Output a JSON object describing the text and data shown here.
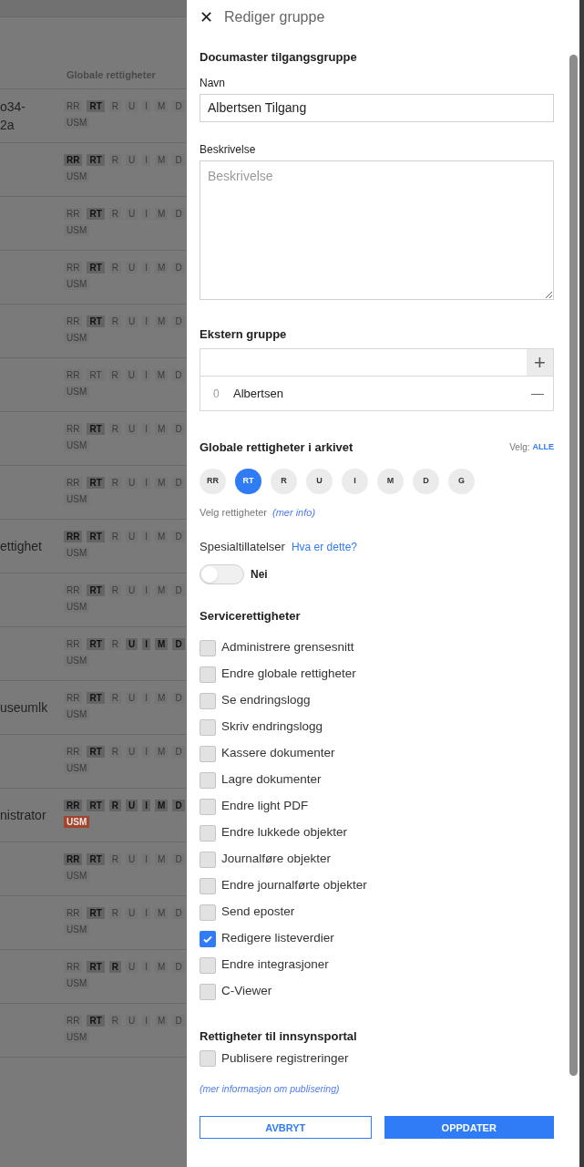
{
  "background_table": {
    "column_header": "Globale rettigheter",
    "rows": [
      {
        "lines": [
          "o34-",
          "2a"
        ],
        "rights": [
          {
            "label": "RR",
            "on": false
          },
          {
            "label": "RT",
            "on": true
          },
          {
            "label": "R",
            "on": false
          },
          {
            "label": "U",
            "on": false
          },
          {
            "label": "I",
            "on": false
          },
          {
            "label": "M",
            "on": false
          },
          {
            "label": "D",
            "on": false
          },
          {
            "label": "USM",
            "on": false
          }
        ]
      },
      {
        "lines": [],
        "rights": [
          {
            "label": "RR",
            "on": true
          },
          {
            "label": "RT",
            "on": true
          },
          {
            "label": "R",
            "on": false
          },
          {
            "label": "U",
            "on": false
          },
          {
            "label": "I",
            "on": false
          },
          {
            "label": "M",
            "on": false
          },
          {
            "label": "D",
            "on": false
          },
          {
            "label": "USM",
            "on": false
          }
        ]
      },
      {
        "lines": [],
        "rights": [
          {
            "label": "RR",
            "on": false
          },
          {
            "label": "RT",
            "on": true
          },
          {
            "label": "R",
            "on": false
          },
          {
            "label": "U",
            "on": false
          },
          {
            "label": "I",
            "on": false
          },
          {
            "label": "M",
            "on": false
          },
          {
            "label": "D",
            "on": false
          },
          {
            "label": "USM",
            "on": false
          }
        ]
      },
      {
        "lines": [],
        "rights": [
          {
            "label": "RR",
            "on": false
          },
          {
            "label": "RT",
            "on": true
          },
          {
            "label": "R",
            "on": false
          },
          {
            "label": "U",
            "on": false
          },
          {
            "label": "I",
            "on": false
          },
          {
            "label": "M",
            "on": false
          },
          {
            "label": "D",
            "on": false
          },
          {
            "label": "USM",
            "on": false
          }
        ]
      },
      {
        "lines": [],
        "rights": [
          {
            "label": "RR",
            "on": false
          },
          {
            "label": "RT",
            "on": true
          },
          {
            "label": "R",
            "on": false
          },
          {
            "label": "U",
            "on": false
          },
          {
            "label": "I",
            "on": false
          },
          {
            "label": "M",
            "on": false
          },
          {
            "label": "D",
            "on": false
          },
          {
            "label": "USM",
            "on": false
          }
        ]
      },
      {
        "lines": [],
        "rights": [
          {
            "label": "RR",
            "on": false
          },
          {
            "label": "RT",
            "on": false
          },
          {
            "label": "R",
            "on": false
          },
          {
            "label": "U",
            "on": false
          },
          {
            "label": "I",
            "on": false
          },
          {
            "label": "M",
            "on": false
          },
          {
            "label": "D",
            "on": false
          },
          {
            "label": "USM",
            "on": false
          }
        ]
      },
      {
        "lines": [],
        "rights": [
          {
            "label": "RR",
            "on": false
          },
          {
            "label": "RT",
            "on": true
          },
          {
            "label": "R",
            "on": false
          },
          {
            "label": "U",
            "on": false
          },
          {
            "label": "I",
            "on": false
          },
          {
            "label": "M",
            "on": false
          },
          {
            "label": "D",
            "on": false
          },
          {
            "label": "USM",
            "on": false
          }
        ]
      },
      {
        "lines": [],
        "rights": [
          {
            "label": "RR",
            "on": false
          },
          {
            "label": "RT",
            "on": true
          },
          {
            "label": "R",
            "on": false
          },
          {
            "label": "U",
            "on": false
          },
          {
            "label": "I",
            "on": false
          },
          {
            "label": "M",
            "on": false
          },
          {
            "label": "D",
            "on": false
          },
          {
            "label": "USM",
            "on": false
          }
        ]
      },
      {
        "lines": [
          "ettighet"
        ],
        "rights": [
          {
            "label": "RR",
            "on": true
          },
          {
            "label": "RT",
            "on": true
          },
          {
            "label": "R",
            "on": false
          },
          {
            "label": "U",
            "on": false
          },
          {
            "label": "I",
            "on": false
          },
          {
            "label": "M",
            "on": false
          },
          {
            "label": "D",
            "on": false
          },
          {
            "label": "USM",
            "on": false
          }
        ]
      },
      {
        "lines": [],
        "rights": [
          {
            "label": "RR",
            "on": false
          },
          {
            "label": "RT",
            "on": true
          },
          {
            "label": "R",
            "on": false
          },
          {
            "label": "U",
            "on": false
          },
          {
            "label": "I",
            "on": false
          },
          {
            "label": "M",
            "on": false
          },
          {
            "label": "D",
            "on": false
          },
          {
            "label": "USM",
            "on": false
          }
        ]
      },
      {
        "lines": [],
        "rights": [
          {
            "label": "RR",
            "on": false
          },
          {
            "label": "RT",
            "on": true
          },
          {
            "label": "R",
            "on": false
          },
          {
            "label": "U",
            "on": true
          },
          {
            "label": "I",
            "on": true
          },
          {
            "label": "M",
            "on": true
          },
          {
            "label": "D",
            "on": true
          },
          {
            "label": "USM",
            "on": false
          }
        ]
      },
      {
        "lines": [
          "useumlk"
        ],
        "rights": [
          {
            "label": "RR",
            "on": false
          },
          {
            "label": "RT",
            "on": true
          },
          {
            "label": "R",
            "on": false
          },
          {
            "label": "U",
            "on": false
          },
          {
            "label": "I",
            "on": false
          },
          {
            "label": "M",
            "on": false
          },
          {
            "label": "D",
            "on": false
          },
          {
            "label": "USM",
            "on": false
          }
        ]
      },
      {
        "lines": [],
        "rights": [
          {
            "label": "RR",
            "on": false
          },
          {
            "label": "RT",
            "on": true
          },
          {
            "label": "R",
            "on": false
          },
          {
            "label": "U",
            "on": false
          },
          {
            "label": "I",
            "on": false
          },
          {
            "label": "M",
            "on": false
          },
          {
            "label": "D",
            "on": false
          },
          {
            "label": "USM",
            "on": false
          }
        ]
      },
      {
        "lines": [
          "nistrator"
        ],
        "rights": [
          {
            "label": "RR",
            "on": true
          },
          {
            "label": "RT",
            "on": true
          },
          {
            "label": "R",
            "on": true
          },
          {
            "label": "U",
            "on": true
          },
          {
            "label": "I",
            "on": true
          },
          {
            "label": "M",
            "on": true
          },
          {
            "label": "D",
            "on": true
          },
          {
            "label": "USM",
            "on": true
          }
        ]
      },
      {
        "lines": [],
        "rights": [
          {
            "label": "RR",
            "on": true
          },
          {
            "label": "RT",
            "on": true
          },
          {
            "label": "R",
            "on": false
          },
          {
            "label": "U",
            "on": false
          },
          {
            "label": "I",
            "on": false
          },
          {
            "label": "M",
            "on": false
          },
          {
            "label": "D",
            "on": false
          },
          {
            "label": "USM",
            "on": false
          }
        ]
      },
      {
        "lines": [],
        "rights": [
          {
            "label": "RR",
            "on": false
          },
          {
            "label": "RT",
            "on": true
          },
          {
            "label": "R",
            "on": false
          },
          {
            "label": "U",
            "on": false
          },
          {
            "label": "I",
            "on": false
          },
          {
            "label": "M",
            "on": false
          },
          {
            "label": "D",
            "on": false
          },
          {
            "label": "USM",
            "on": false
          }
        ]
      },
      {
        "lines": [],
        "rights": [
          {
            "label": "RR",
            "on": false
          },
          {
            "label": "RT",
            "on": true
          },
          {
            "label": "R",
            "on": true
          },
          {
            "label": "U",
            "on": false
          },
          {
            "label": "I",
            "on": false
          },
          {
            "label": "M",
            "on": false
          },
          {
            "label": "D",
            "on": false
          },
          {
            "label": "USM",
            "on": false
          }
        ]
      },
      {
        "lines": [],
        "rights": [
          {
            "label": "RR",
            "on": false
          },
          {
            "label": "RT",
            "on": true
          },
          {
            "label": "R",
            "on": false
          },
          {
            "label": "U",
            "on": false
          },
          {
            "label": "I",
            "on": false
          },
          {
            "label": "M",
            "on": false
          },
          {
            "label": "D",
            "on": false
          },
          {
            "label": "USM",
            "on": false
          }
        ]
      }
    ]
  },
  "panel": {
    "close": "✕",
    "title": "Rediger gruppe",
    "section_title": "Documaster tilgangsgruppe",
    "name_label": "Navn",
    "name_value": "Albertsen Tilgang",
    "description_label": "Beskrivelse",
    "description_placeholder": "Beskrivelse",
    "external_title": "Ekstern gruppe",
    "external_add": "+",
    "external_groups": [
      {
        "index": "0",
        "name": "Albertsen",
        "remove": "—"
      }
    ],
    "global_title": "Globale rettigheter i arkivet",
    "select_label": "Velg:",
    "select_all": "ALLE",
    "global_rights": [
      {
        "label": "RR",
        "selected": false
      },
      {
        "label": "RT",
        "selected": true
      },
      {
        "label": "R",
        "selected": false
      },
      {
        "label": "U",
        "selected": false
      },
      {
        "label": "I",
        "selected": false
      },
      {
        "label": "M",
        "selected": false
      },
      {
        "label": "D",
        "selected": false
      },
      {
        "label": "G",
        "selected": false
      }
    ],
    "rights_hint": "Velg rettigheter",
    "rights_more": "(mer info)",
    "special_label": "Spesialtillatelser",
    "special_link": "Hva er dette?",
    "special_on": false,
    "special_value": "Nei",
    "service_title": "Servicerettigheter",
    "service_rights": [
      {
        "label": "Administrere grensesnitt",
        "checked": false
      },
      {
        "label": "Endre globale rettigheter",
        "checked": false
      },
      {
        "label": "Se endringslogg",
        "checked": false
      },
      {
        "label": "Skriv endringslogg",
        "checked": false
      },
      {
        "label": "Kassere dokumenter",
        "checked": false
      },
      {
        "label": "Lagre dokumenter",
        "checked": false
      },
      {
        "label": "Endre light PDF",
        "checked": false
      },
      {
        "label": "Endre lukkede objekter",
        "checked": false
      },
      {
        "label": "Journalføre objekter",
        "checked": false
      },
      {
        "label": "Endre journalførte objekter",
        "checked": false
      },
      {
        "label": "Send eposter",
        "checked": false
      },
      {
        "label": "Redigere listeverdier",
        "checked": true
      },
      {
        "label": "Endre integrasjoner",
        "checked": false
      },
      {
        "label": "C-Viewer",
        "checked": false
      }
    ],
    "portal_title": "Rettigheter til innsynsportal",
    "portal_rights": [
      {
        "label": "Publisere registreringer",
        "checked": false
      }
    ],
    "portal_more": "(mer informasjon om publisering)",
    "cancel": "AVBRYT",
    "submit": "OPPDATER"
  }
}
